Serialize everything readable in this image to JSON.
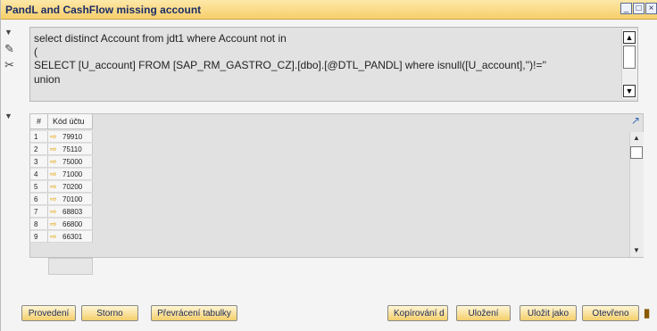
{
  "window": {
    "title": "PandL and CashFlow missing account",
    "controls": {
      "minimize": "_",
      "maximize": "□",
      "close": "×"
    }
  },
  "query": {
    "lines": [
      "select distinct Account from jdt1 where  Account not in",
      "(",
      "SELECT [U_account] FROM [SAP_RM_GASTRO_CZ].[dbo].[@DTL_PANDL] where isnull([U_account],'')!=''",
      "union"
    ]
  },
  "grid": {
    "headers": {
      "num": "#",
      "code": "Kód účtu"
    },
    "rows": [
      {
        "num": "1",
        "code": "79910"
      },
      {
        "num": "2",
        "code": "75110"
      },
      {
        "num": "3",
        "code": "75000"
      },
      {
        "num": "4",
        "code": "71000"
      },
      {
        "num": "5",
        "code": "70200"
      },
      {
        "num": "6",
        "code": "70100"
      },
      {
        "num": "7",
        "code": "68803"
      },
      {
        "num": "8",
        "code": "66800"
      },
      {
        "num": "9",
        "code": "66301"
      }
    ]
  },
  "buttons": {
    "execute": "Provedení",
    "cancel": "Storno",
    "transpose": "Převrácení tabulky",
    "copy": "Kopírování d",
    "save": "Uložení",
    "save_as": "Uložit jako",
    "open": "Otevřeno"
  },
  "icons": {
    "pencil": "✎",
    "scissors": "✂",
    "expand_arrow": "▼",
    "row_link_arrow": "⇨",
    "grid_link": "↗"
  }
}
